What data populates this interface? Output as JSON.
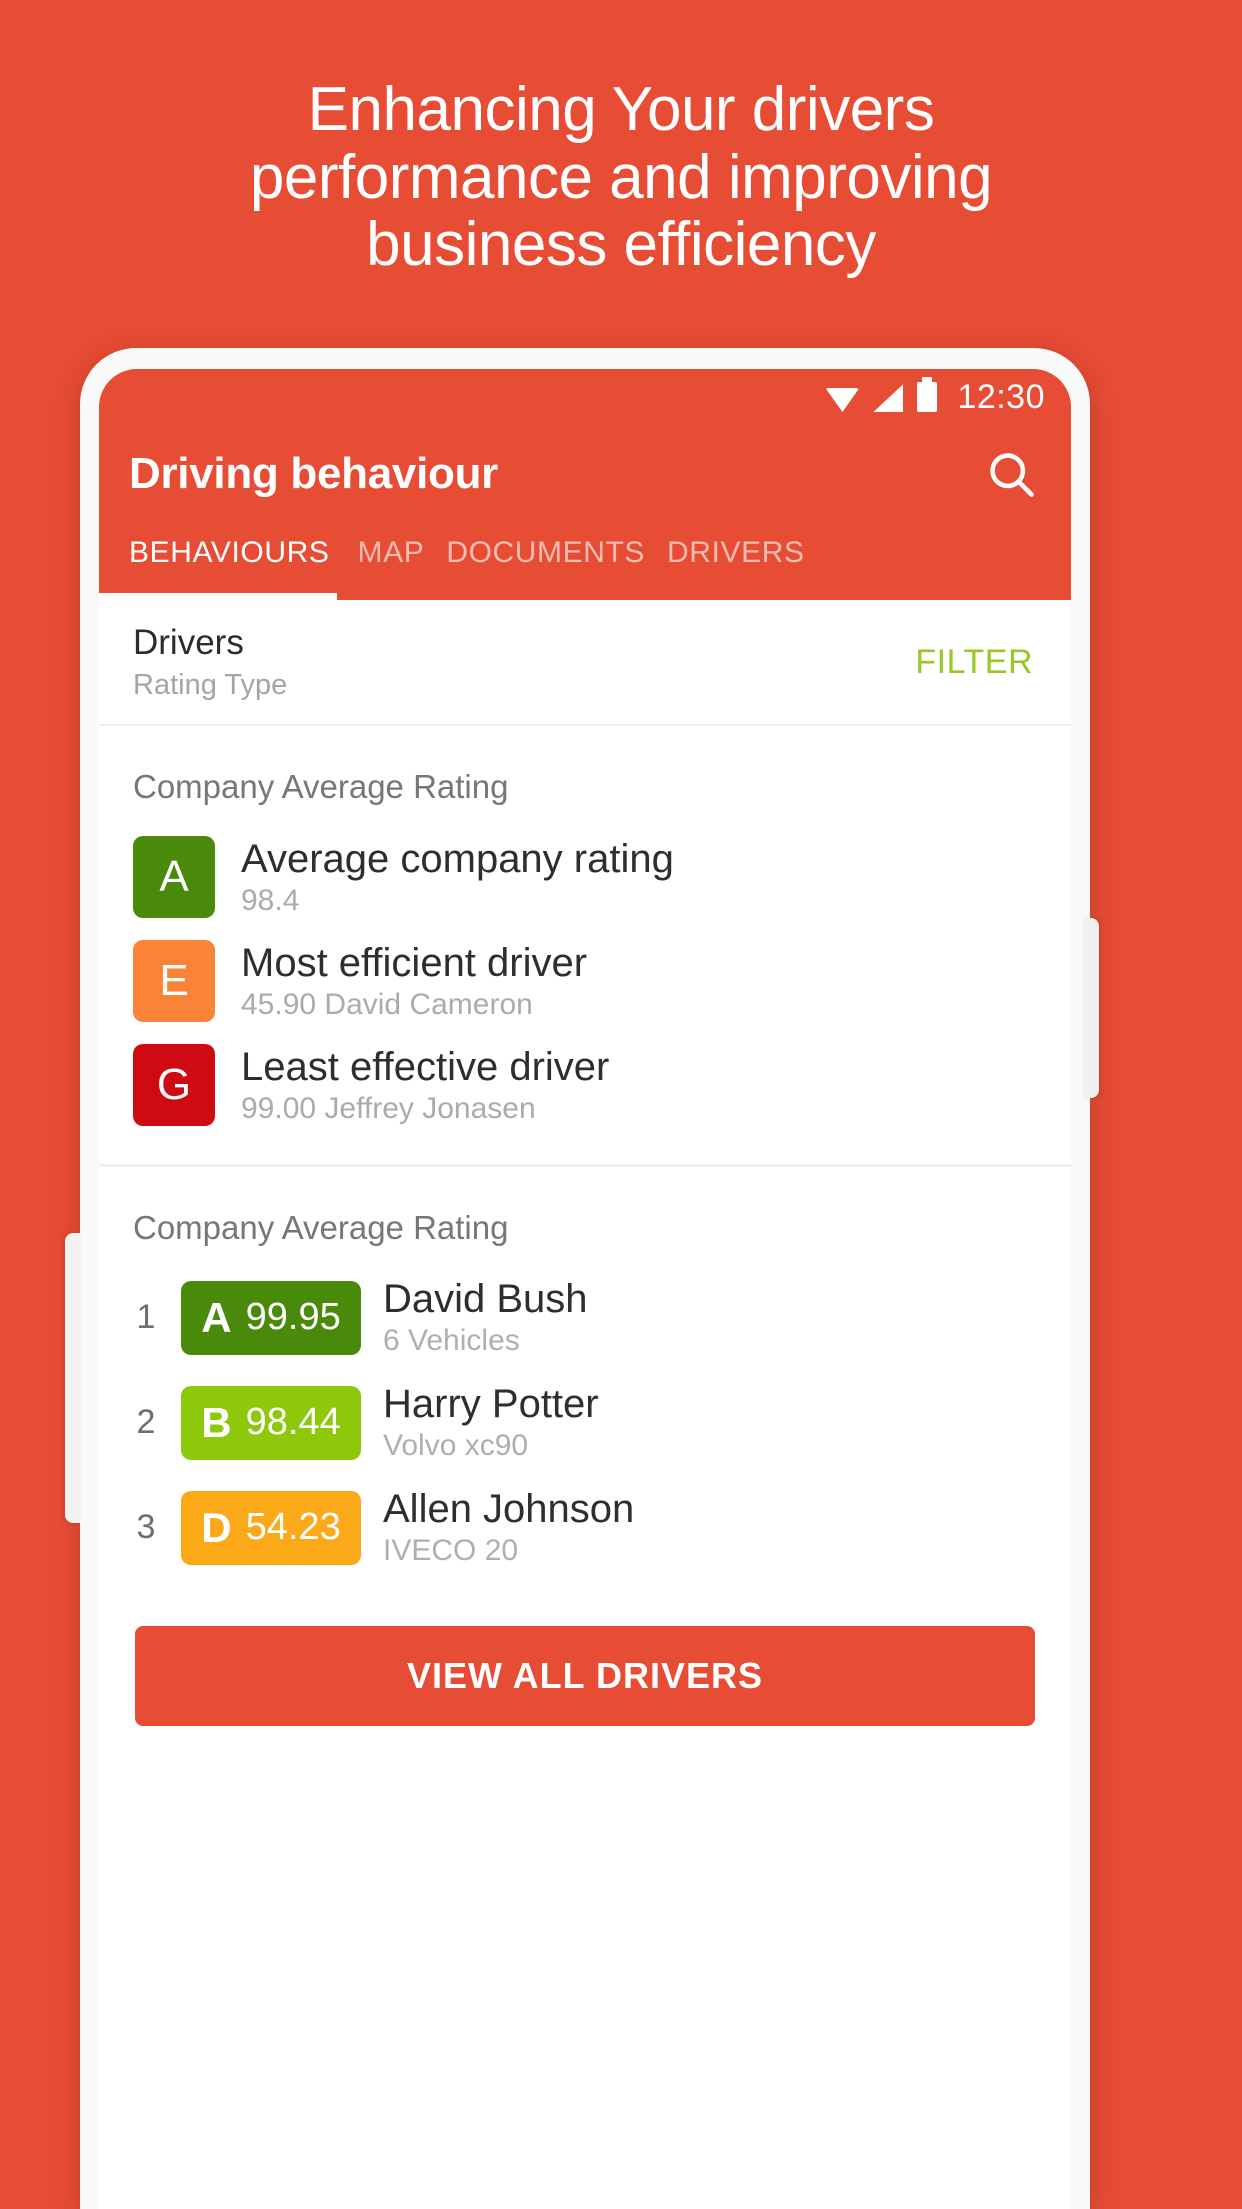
{
  "theme": {
    "brand": "#E74C34",
    "accent_green": "#9BC628",
    "grade_a": "#4A8A0A",
    "grade_b": "#8DC80A",
    "grade_d": "#FBA918",
    "grade_e": "#F98438",
    "grade_g": "#D00A12"
  },
  "headline": {
    "line1": "Enhancing Your drivers",
    "line2": "performance and improving",
    "line3": "business efficiency"
  },
  "statusbar": {
    "time": "12:30",
    "wifi_icon": "wifi-icon",
    "signal_icon": "signal-icon",
    "battery_icon": "battery-icon"
  },
  "appbar": {
    "title": "Driving behaviour",
    "search_icon": "search-icon"
  },
  "tabs": [
    {
      "label": "BEHAVIOURS",
      "active": true
    },
    {
      "label": "MAP",
      "active": false
    },
    {
      "label": "DOCUMENTS",
      "active": false
    },
    {
      "label": "DRIVERS",
      "active": false
    }
  ],
  "filter_row": {
    "title": "Drivers",
    "subtitle": "Rating Type",
    "action": "FILTER"
  },
  "summary_card": {
    "title": "Company Average Rating",
    "rows": [
      {
        "grade": "A",
        "color": "#4A8A0A",
        "title": "Average company rating",
        "subtitle": "98.4"
      },
      {
        "grade": "E",
        "color": "#F98438",
        "title": "Most efficient driver",
        "subtitle": "45.90 David Cameron"
      },
      {
        "grade": "G",
        "color": "#D00A12",
        "title": "Least effective driver",
        "subtitle": "99.00 Jeffrey Jonasen"
      }
    ]
  },
  "ranking_card": {
    "title": "Company Average Rating",
    "rows": [
      {
        "rank": "1",
        "grade": "A",
        "score": "99.95",
        "color": "#4A8A0A",
        "name": "David Bush",
        "subtitle": "6 Vehicles"
      },
      {
        "rank": "2",
        "grade": "B",
        "score": "98.44",
        "color": "#8DC80A",
        "name": "Harry Potter",
        "subtitle": "Volvo xc90"
      },
      {
        "rank": "3",
        "grade": "D",
        "score": "54.23",
        "color": "#FBA918",
        "name": "Allen Johnson",
        "subtitle": "IVECO 20"
      }
    ],
    "cta_label": "VIEW ALL DRIVERS"
  }
}
